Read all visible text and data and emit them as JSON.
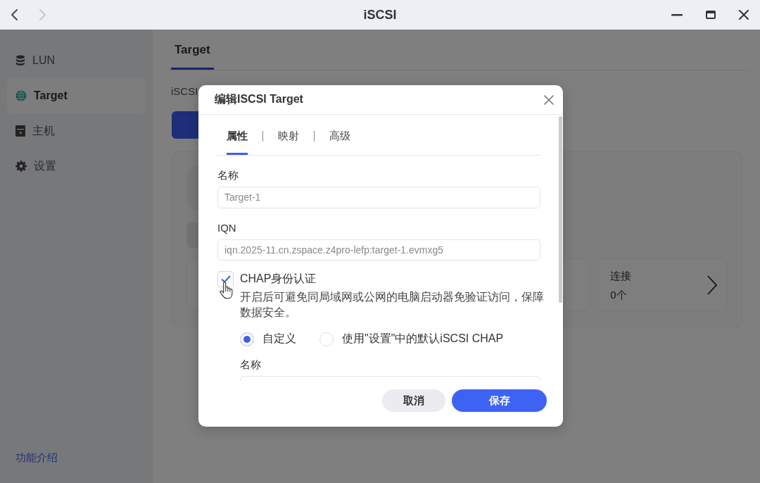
{
  "window": {
    "title": "iSCSI",
    "nav": [
      {
        "kind": "back",
        "disabled": false
      },
      {
        "kind": "forward",
        "disabled": true
      }
    ]
  },
  "sidebar": {
    "items": [
      {
        "label": "LUN",
        "selected": false
      },
      {
        "label": "Target",
        "selected": true
      },
      {
        "label": "主机",
        "selected": false
      },
      {
        "label": "设置",
        "selected": false
      }
    ],
    "footer_link": "功能介绍"
  },
  "main": {
    "tabs": [
      {
        "label": "Target",
        "selected": true
      }
    ],
    "intro": "iSCSI",
    "stats": [
      {
        "label": "连接",
        "value": "0个"
      }
    ]
  },
  "dialog": {
    "title": "编辑ISCSI Target",
    "tabs": [
      {
        "label": "属性",
        "selected": true
      },
      {
        "label": "映射",
        "selected": false
      },
      {
        "label": "高级",
        "selected": false
      }
    ],
    "fields": [
      {
        "label": "名称",
        "value": "Target-1",
        "disabled": true
      },
      {
        "label": "IQN",
        "value": "iqn.2025-11.cn.zspace.z4pro-lefp:target-1.evmxg5",
        "disabled": true
      }
    ],
    "chap": {
      "label": "CHAP身份认证",
      "checked": true,
      "description": "开启后可避免同局域网或公网的电脑启动器免验证访问，保障数据安全。",
      "options": [
        {
          "label": "自定义",
          "selected": true
        },
        {
          "label": "使用\"设置\"中的默认iSCSI CHAP",
          "selected": false
        }
      ],
      "fields": [
        {
          "label": "名称"
        }
      ]
    },
    "buttons": [
      {
        "label": "取消",
        "kind": "secondary"
      },
      {
        "label": "保存",
        "kind": "primary"
      }
    ]
  }
}
